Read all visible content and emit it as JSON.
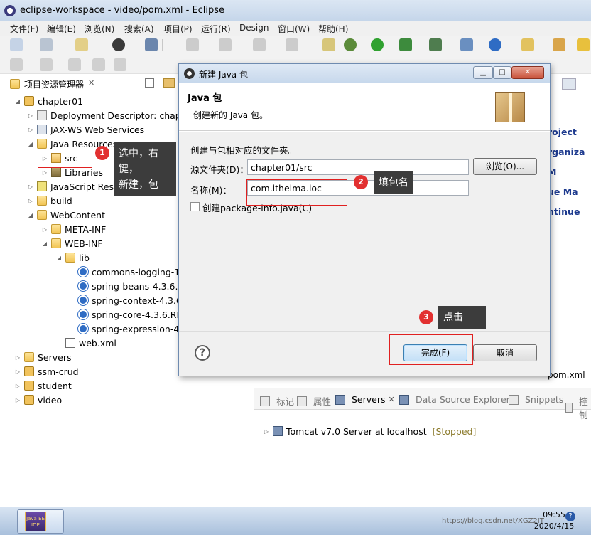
{
  "window": {
    "title": "eclipse-workspace - video/pom.xml - Eclipse"
  },
  "menu": [
    "文件(F)",
    "编辑(E)",
    "浏览(N)",
    "搜索(A)",
    "项目(P)",
    "运行(R)",
    "Design",
    "窗口(W)",
    "帮助(H)"
  ],
  "explorer": {
    "title": "项目资源管理器",
    "tree": [
      {
        "label": "chapter01",
        "icon": "project-icon"
      },
      {
        "label": "Deployment Descriptor: chapte",
        "icon": "descriptor-icon"
      },
      {
        "label": "JAX-WS Web Services",
        "icon": "webservice-icon"
      },
      {
        "label": "Java Resources",
        "icon": "java-resources-icon"
      },
      {
        "label": "src",
        "icon": "package-folder-icon"
      },
      {
        "label": "Libraries",
        "icon": "library-icon"
      },
      {
        "label": "JavaScript Resources",
        "icon": "javascript-icon"
      },
      {
        "label": "build",
        "icon": "folder-icon"
      },
      {
        "label": "WebContent",
        "icon": "folder-icon"
      },
      {
        "label": "META-INF",
        "icon": "folder-icon"
      },
      {
        "label": "WEB-INF",
        "icon": "folder-icon"
      },
      {
        "label": "lib",
        "icon": "folder-icon"
      },
      {
        "label": "commons-logging-1",
        "icon": "jar-icon"
      },
      {
        "label": "spring-beans-4.3.6.R",
        "icon": "jar-icon"
      },
      {
        "label": "spring-context-4.3.6.",
        "icon": "jar-icon"
      },
      {
        "label": "spring-core-4.3.6.RE",
        "icon": "jar-icon"
      },
      {
        "label": "spring-expression-4.",
        "icon": "jar-icon"
      },
      {
        "label": "web.xml",
        "icon": "xml-icon"
      },
      {
        "label": "Servers",
        "icon": "folder-icon"
      },
      {
        "label": "ssm-crud",
        "icon": "project-icon"
      },
      {
        "label": "student",
        "icon": "project-icon"
      },
      {
        "label": "video",
        "icon": "project-icon"
      }
    ]
  },
  "editor_strip": [
    "roject",
    "rganiza",
    "M",
    "ue Ma",
    "ntinue"
  ],
  "editor_tab": "pom.xml",
  "dialog": {
    "title": "新建 Java 包",
    "header_title": "Java 包",
    "header_desc": "创建新的 Java 包。",
    "instruction": "创建与包相对应的文件夹。",
    "source_label": "源文件夹(D)：",
    "source_value": "chapter01/src",
    "browse_label": "浏览(O)...",
    "name_label": "名称(M)：",
    "name_value": "com.itheima.ioc",
    "checkbox_label": "创建package-info.java(C)",
    "finish_label": "完成(F)",
    "cancel_label": "取消",
    "help_label": "?"
  },
  "servers_view": {
    "tabs": [
      "标记",
      "属性",
      "Servers",
      "Data Source Explorer",
      "Snippets",
      "控制"
    ],
    "server_name": "Tomcat v7.0 Server at localhost",
    "server_status": "[Stopped]"
  },
  "annotations": [
    {
      "number": "1",
      "text_lines": [
        "选中，右键，",
        "新建，包"
      ]
    },
    {
      "number": "2",
      "text": "填包名"
    },
    {
      "number": "3",
      "text": "点击"
    }
  ],
  "taskbar": {
    "app_label": "Java EE IDE",
    "time": "09:55",
    "date": "2020/4/15",
    "watermark": "https://blog.csdn.net/XGZ2IT"
  }
}
